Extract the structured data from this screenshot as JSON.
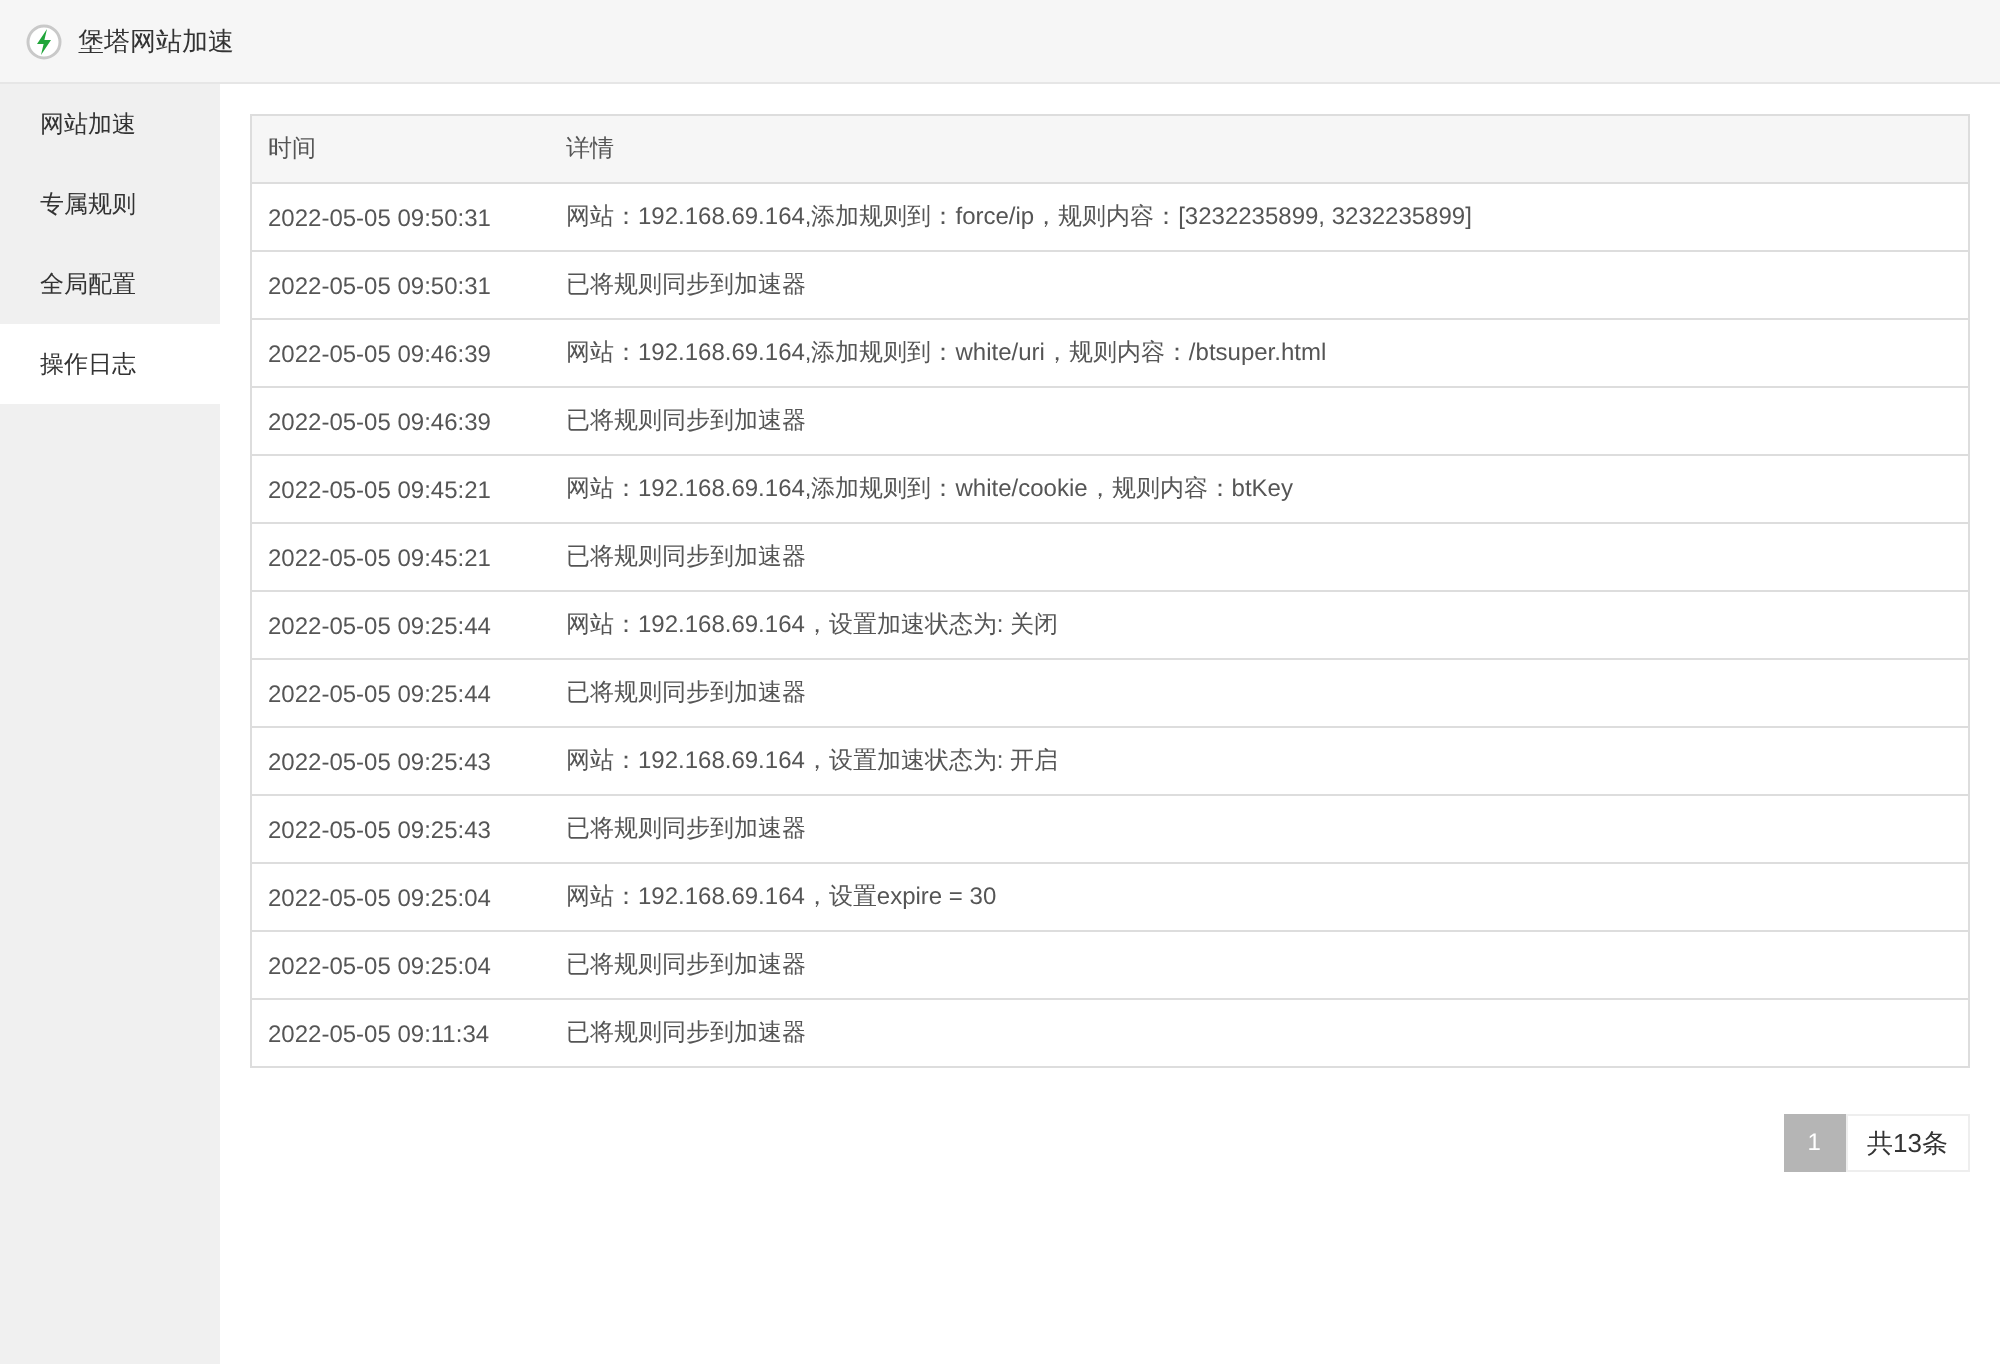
{
  "window": {
    "title": "堡塔网站加速"
  },
  "sidebar": {
    "items": [
      {
        "label": "网站加速",
        "selected": false
      },
      {
        "label": "专属规则",
        "selected": false
      },
      {
        "label": "全局配置",
        "selected": false
      },
      {
        "label": "操作日志",
        "selected": true
      }
    ]
  },
  "table": {
    "columns": [
      "时间",
      "详情"
    ],
    "rows": [
      [
        "2022-05-05 09:50:31",
        "网站：192.168.69.164,添加规则到：force/ip，规则内容：[3232235899, 3232235899]"
      ],
      [
        "2022-05-05 09:50:31",
        "已将规则同步到加速器"
      ],
      [
        "2022-05-05 09:46:39",
        "网站：192.168.69.164,添加规则到：white/uri，规则内容：/btsuper.html"
      ],
      [
        "2022-05-05 09:46:39",
        "已将规则同步到加速器"
      ],
      [
        "2022-05-05 09:45:21",
        "网站：192.168.69.164,添加规则到：white/cookie，规则内容：btKey"
      ],
      [
        "2022-05-05 09:45:21",
        "已将规则同步到加速器"
      ],
      [
        "2022-05-05 09:25:44",
        "网站：192.168.69.164，设置加速状态为: 关闭"
      ],
      [
        "2022-05-05 09:25:44",
        "已将规则同步到加速器"
      ],
      [
        "2022-05-05 09:25:43",
        "网站：192.168.69.164，设置加速状态为: 开启"
      ],
      [
        "2022-05-05 09:25:43",
        "已将规则同步到加速器"
      ],
      [
        "2022-05-05 09:25:04",
        "网站：192.168.69.164，设置expire = 30"
      ],
      [
        "2022-05-05 09:25:04",
        "已将规则同步到加速器"
      ],
      [
        "2022-05-05 09:11:34",
        "已将规则同步到加速器"
      ]
    ]
  },
  "pagination": {
    "pages": [
      {
        "label": "1",
        "selected": true
      }
    ],
    "total": "共13条"
  }
}
